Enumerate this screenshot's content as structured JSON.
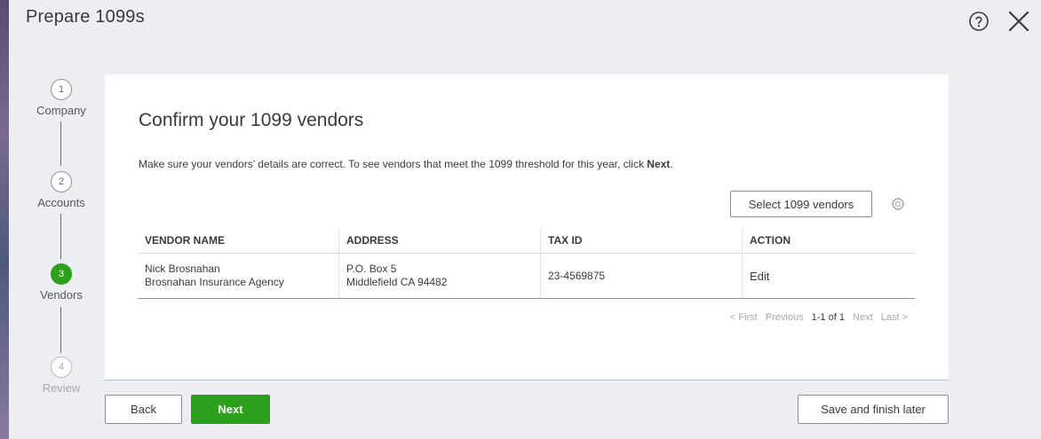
{
  "window": {
    "title": "Prepare 1099s",
    "help_icon": "help-circle-icon",
    "close_icon": "close-icon"
  },
  "stepper": {
    "steps": [
      {
        "number": "1",
        "label": "Company",
        "state": "done"
      },
      {
        "number": "2",
        "label": "Accounts",
        "state": "done"
      },
      {
        "number": "3",
        "label": "Vendors",
        "state": "active"
      },
      {
        "number": "4",
        "label": "Review",
        "state": "disabled"
      }
    ]
  },
  "main": {
    "heading": "Confirm your 1099 vendors",
    "description_prefix": "Make sure your vendors’ details are correct. To see vendors that meet the 1099 threshold for this year, click ",
    "description_bold": "Next",
    "description_suffix": ".",
    "select_vendors_label": "Select 1099 vendors",
    "gear_icon": "gear-icon"
  },
  "table": {
    "columns": [
      "VENDOR NAME",
      "ADDRESS",
      "TAX ID",
      "ACTION"
    ],
    "rows": [
      {
        "vendor_name_line1": "Nick Brosnahan",
        "vendor_name_line2": "Brosnahan Insurance Agency",
        "address_line1": "P.O. Box 5",
        "address_line2": "Middlefield CA 94482",
        "tax_id": "23-4569875",
        "action": "Edit"
      }
    ]
  },
  "pager": {
    "first": "< First",
    "previous": "Previous",
    "range": "1-1 of 1",
    "next": "Next",
    "last": "Last >"
  },
  "footer": {
    "back_label": "Back",
    "next_label": "Next",
    "save_later_label": "Save and finish later"
  },
  "colors": {
    "accent_green": "#2ca01c",
    "background": "#eceef1",
    "card": "#ffffff"
  }
}
